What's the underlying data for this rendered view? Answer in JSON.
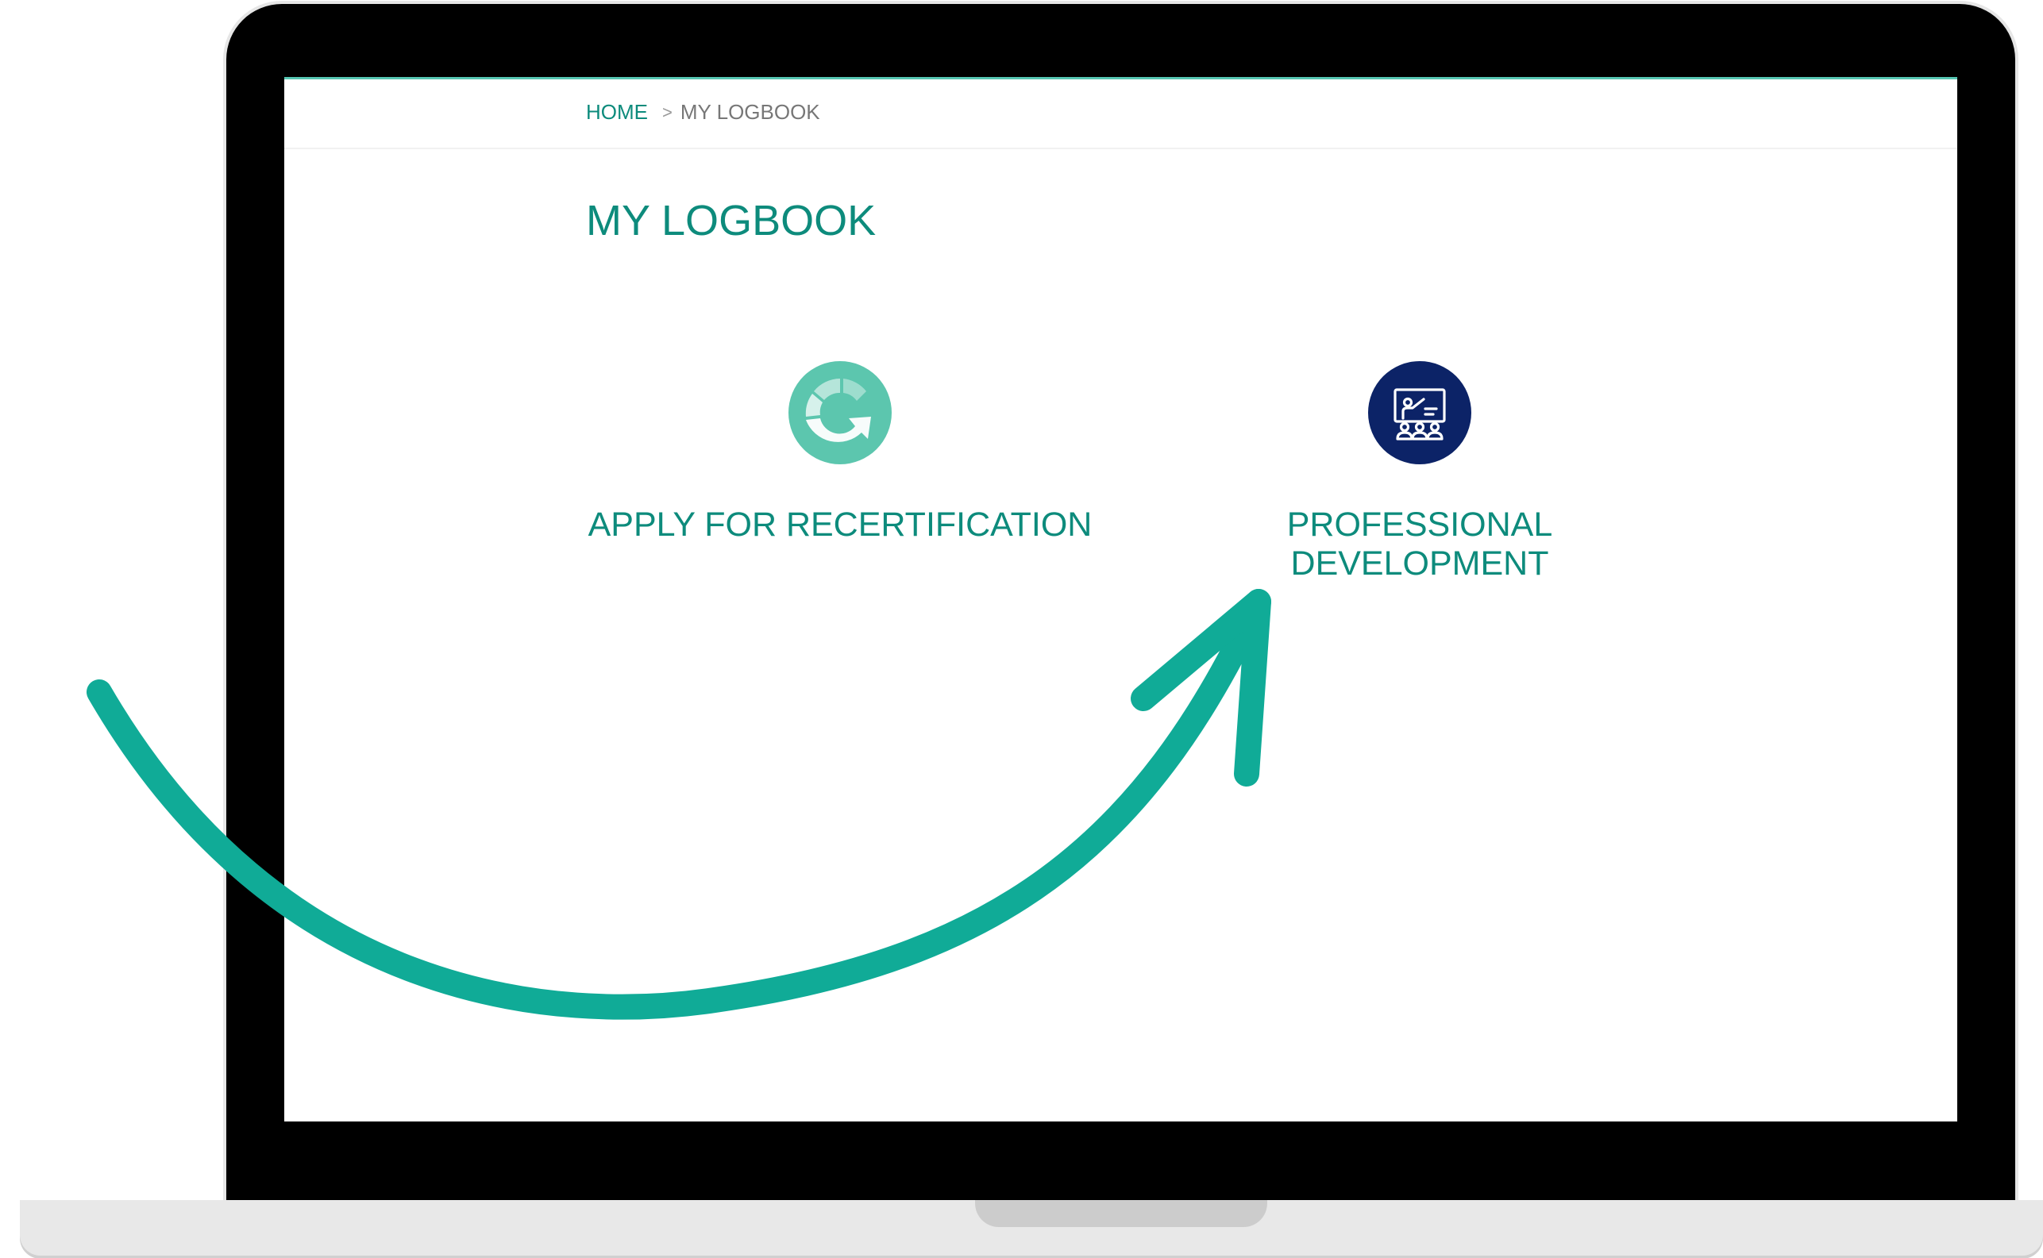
{
  "breadcrumb": {
    "home": "HOME",
    "separator": ">",
    "current": "MY LOGBOOK"
  },
  "page": {
    "title": "MY LOGBOOK"
  },
  "tiles": [
    {
      "label": "APPLY FOR RECERTIFICATION",
      "icon": "recertification-icon",
      "color": "#5cc6ae"
    },
    {
      "label": "PROFESSIONAL DEVELOPMENT",
      "icon": "presentation-icon",
      "color": "#0c2367"
    }
  ],
  "colors": {
    "accent": "#0d8b7c",
    "arrow": "#10ab97",
    "screen_background": "#ffffff",
    "laptop_frame": "#000000"
  }
}
